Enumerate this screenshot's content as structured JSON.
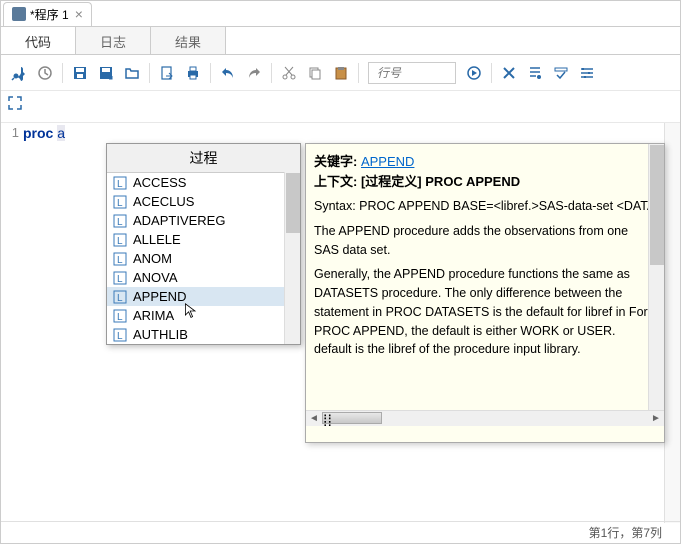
{
  "window": {
    "tab_title": "*程序 1"
  },
  "tabs": {
    "code": "代码",
    "log": "日志",
    "results": "结果"
  },
  "toolbar": {
    "line_placeholder": "行号"
  },
  "editor": {
    "line_number": "1",
    "keyword": "proc ",
    "typed": "a"
  },
  "autocomplete": {
    "header": "过程",
    "items": [
      "ACCESS",
      "ACECLUS",
      "ADAPTIVEREG",
      "ALLELE",
      "ANOM",
      "ANOVA",
      "APPEND",
      "ARIMA",
      "AUTHLIB"
    ],
    "selected_index": 6
  },
  "doc": {
    "kw_label": "关键字:",
    "kw_link": "APPEND",
    "ctx_label": "上下文:",
    "ctx_bracket": "[过程定义]",
    "ctx_proc": "PROC APPEND",
    "syntax": "Syntax: PROC APPEND BASE=<libref.>SAS-data-set <DATA",
    "p1": "The APPEND procedure adds the observations from one SAS data set.",
    "p2": "Generally, the APPEND procedure functions the same as DATASETS procedure. The only difference between the statement in PROC DATASETS is the default for libref in For PROC APPEND, the default is either WORK or USER. default is the libref of the procedure input library."
  },
  "status": {
    "position": "第1行，第7列"
  }
}
